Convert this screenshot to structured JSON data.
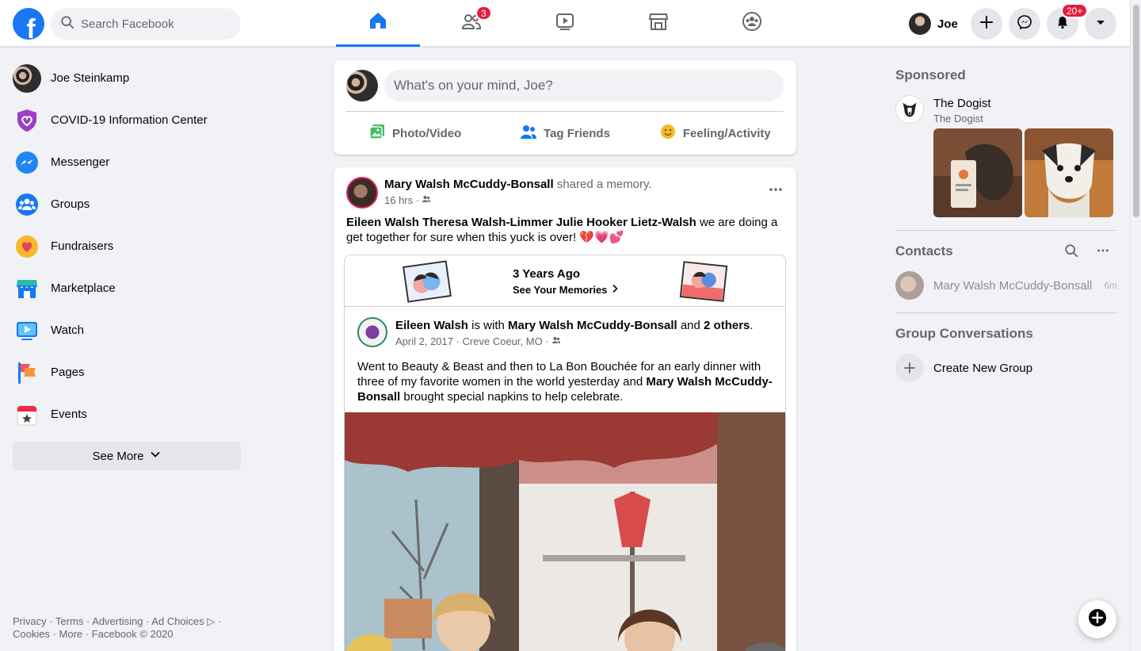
{
  "header": {
    "logo_letter": "f",
    "search_placeholder": "Search Facebook",
    "nav_tabs": [
      {
        "name": "home",
        "icon": "home-icon",
        "active": true
      },
      {
        "name": "friends",
        "icon": "friends-icon",
        "badge": "3"
      },
      {
        "name": "watch",
        "icon": "watch-icon"
      },
      {
        "name": "marketplace",
        "icon": "marketplace-icon"
      },
      {
        "name": "groups",
        "icon": "groups-icon"
      }
    ],
    "profile_name": "Joe",
    "notifications_badge": "20+",
    "accent_color": "#1877f2"
  },
  "sidebar": {
    "items": [
      {
        "label": "Joe Steinkamp",
        "icon": "avatar"
      },
      {
        "label": "COVID-19 Information Center",
        "icon": "covid-shield-icon"
      },
      {
        "label": "Messenger",
        "icon": "messenger-icon"
      },
      {
        "label": "Groups",
        "icon": "groups-icon"
      },
      {
        "label": "Fundraisers",
        "icon": "fundraisers-icon"
      },
      {
        "label": "Marketplace",
        "icon": "marketplace-icon"
      },
      {
        "label": "Watch",
        "icon": "watch-icon"
      },
      {
        "label": "Pages",
        "icon": "pages-flag-icon"
      },
      {
        "label": "Events",
        "icon": "events-calendar-icon"
      }
    ],
    "see_more": "See More"
  },
  "footer": {
    "line1": "Privacy · Terms · Advertising · Ad Choices ▷ ·",
    "line2": "Cookies · More · Facebook © 2020"
  },
  "composer": {
    "placeholder": "What's on your mind, Joe?",
    "actions": [
      "Photo/Video",
      "Tag Friends",
      "Feeling/Activity"
    ]
  },
  "post": {
    "author": "Mary Walsh McCuddy-Bonsall",
    "action": "shared a memory.",
    "time": "16 hrs ·",
    "tagged_names": "Eileen Walsh Theresa Walsh-Limmer Julie Hooker Lietz-Walsh",
    "text": " we are doing a get together for sure when this yuck is over! ",
    "emojis": "💔💗💕",
    "memory": {
      "title": "3 Years Ago",
      "link": "See Your Memories",
      "inner_author": "Eileen Walsh",
      "inner_with": "is with",
      "inner_tagged": "Mary Walsh McCuddy-Bonsall",
      "inner_and": "and",
      "inner_others": "2 others",
      "inner_meta": "April 2, 2017 · Creve Coeur, MO ·",
      "inner_text": "Went to Beauty & Beast and then to La Bon Bouchée for an early dinner with three of my favorite women in the world yesterday and ",
      "inner_text_bold": "Mary Walsh McCuddy-Bonsall",
      "inner_text_end": " brought special napkins to help celebrate."
    }
  },
  "right": {
    "sponsored_title": "Sponsored",
    "sponsor_name": "The Dogist",
    "sponsor_sub": "The Dogist",
    "contacts_title": "Contacts",
    "contacts": [
      {
        "name": "Mary Walsh McCuddy-Bonsall",
        "time": "6m"
      }
    ],
    "group_conv_title": "Group Conversations",
    "create_group": "Create New Group"
  }
}
